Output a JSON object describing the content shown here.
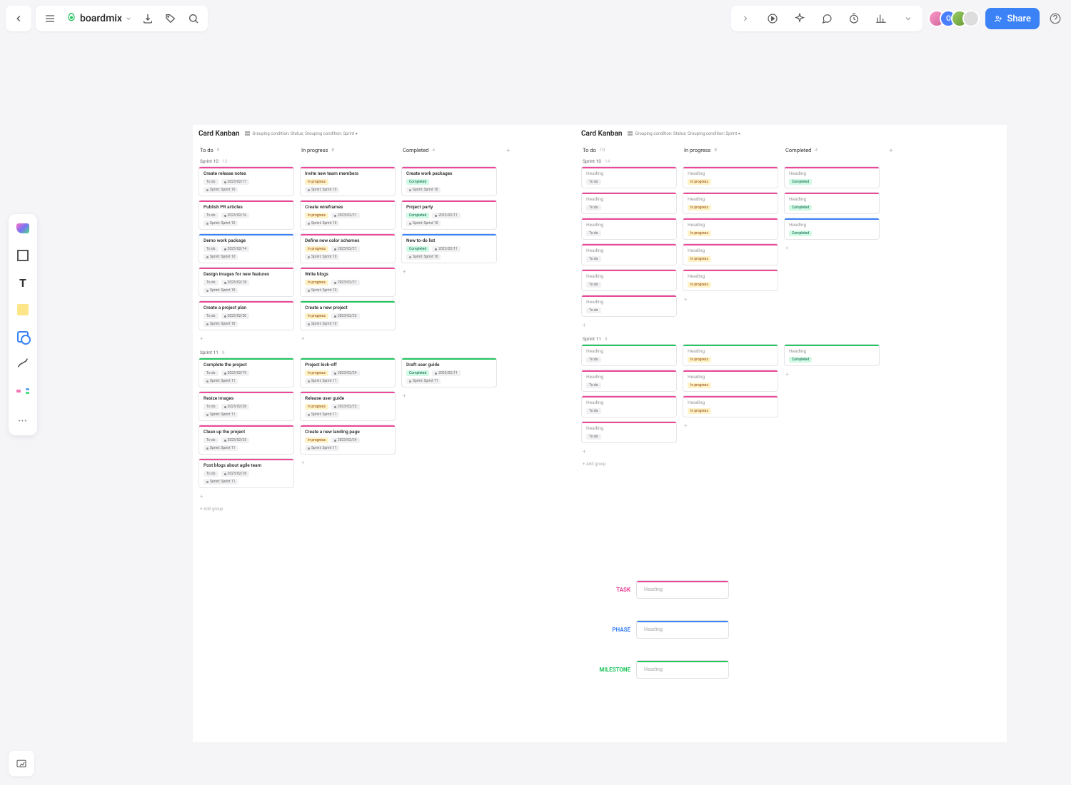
{
  "app": {
    "title": "boardmix",
    "share": "Share"
  },
  "status_labels": {
    "todo": "To do",
    "inprogress": "In progress",
    "completed": "Completed"
  },
  "board1": {
    "title": "Card Kanban",
    "condition": "Grouping condition: Status; Grouping condition: Sprint ▾",
    "columns": [
      {
        "name": "To do",
        "count": 9
      },
      {
        "name": "In progress",
        "count": 8
      },
      {
        "name": "Completed",
        "count": 4
      }
    ],
    "groups": [
      {
        "name": "Sprint 10",
        "count": 13,
        "cols": [
          [
            {
              "title": "Create release notes",
              "status": "todo",
              "date": "2023/02/17",
              "sprint": "Sprint: Sprint 10",
              "color": "pink"
            },
            {
              "title": "Publish PR articles",
              "status": "todo",
              "date": "2023/02/16",
              "sprint": "Sprint: Sprint 10",
              "color": "pink"
            },
            {
              "title": "Demo work package",
              "status": "todo",
              "date": "2023/02/14",
              "sprint": "Sprint: Sprint 10",
              "color": "blue"
            },
            {
              "title": "Design images for new features",
              "status": "todo",
              "date": "2023/02/18",
              "sprint": "Sprint: Sprint 10",
              "color": "pink"
            },
            {
              "title": "Create a project plan",
              "status": "todo",
              "date": "2023/02/20",
              "sprint": "Sprint: Sprint 10",
              "color": "pink"
            }
          ],
          [
            {
              "title": "Invite new team members",
              "status": "inprogress",
              "date": "",
              "sprint": "Sprint: Sprint 10",
              "color": "pink"
            },
            {
              "title": "Create wireframes",
              "status": "inprogress",
              "date": "2023/02/21",
              "sprint": "Sprint: Sprint 10",
              "color": "pink"
            },
            {
              "title": "Define new color schemes",
              "status": "inprogress",
              "date": "2023/02/21",
              "sprint": "Sprint: Sprint 10",
              "color": "pink"
            },
            {
              "title": "Write blogs",
              "status": "inprogress",
              "date": "2023/02/21",
              "sprint": "Sprint: Sprint 10",
              "color": "pink"
            },
            {
              "title": "Create a new project",
              "status": "inprogress",
              "date": "2023/02/22",
              "sprint": "Sprint: Sprint 10",
              "color": "green"
            }
          ],
          [
            {
              "title": "Create work packages",
              "status": "completed",
              "date": "",
              "sprint": "Sprint: Sprint 10",
              "color": "pink"
            },
            {
              "title": "Project party",
              "status": "completed",
              "date": "2023/02/11",
              "sprint": "Sprint: Sprint 10",
              "color": "pink"
            },
            {
              "title": "New to-do list",
              "status": "completed",
              "date": "2023/02/11",
              "sprint": "Sprint: Sprint 10",
              "color": "blue"
            }
          ]
        ]
      },
      {
        "name": "Sprint 11",
        "count": 8,
        "cols": [
          [
            {
              "title": "Complete the project",
              "status": "todo",
              "date": "2023/02/19",
              "sprint": "Sprint: Sprint 11",
              "color": "green"
            },
            {
              "title": "Resize images",
              "status": "todo",
              "date": "2023/02/28",
              "sprint": "Sprint: Sprint 11",
              "color": "pink"
            },
            {
              "title": "Clean up the project",
              "status": "todo",
              "date": "2023/02/25",
              "sprint": "Sprint: Sprint 11",
              "color": "pink"
            },
            {
              "title": "Post blogs about agile team",
              "status": "todo",
              "date": "2023/02/18",
              "sprint": "Sprint: Sprint 11",
              "color": "pink"
            }
          ],
          [
            {
              "title": "Project kick-off",
              "status": "inprogress",
              "date": "2023/02/24",
              "sprint": "Sprint: Sprint 11",
              "color": "green"
            },
            {
              "title": "Release user guide",
              "status": "inprogress",
              "date": "2023/02/23",
              "sprint": "Sprint: Sprint 11",
              "color": "pink"
            },
            {
              "title": "Create a new landing page",
              "status": "inprogress",
              "date": "2023/02/24",
              "sprint": "Sprint: Sprint 11",
              "color": "pink"
            }
          ],
          [
            {
              "title": "Draft user guide",
              "status": "completed",
              "date": "2023/02/11",
              "sprint": "Sprint: Sprint 11",
              "color": "green"
            }
          ]
        ]
      }
    ],
    "add_group": "Add group"
  },
  "board2": {
    "title": "Card Kanban",
    "condition": "Grouping condition: Status; Grouping condition: Sprint ▾",
    "columns": [
      {
        "name": "To do",
        "count": 10
      },
      {
        "name": "In progress",
        "count": 8
      },
      {
        "name": "Completed",
        "count": 4
      }
    ],
    "groups": [
      {
        "name": "Sprint 10",
        "count": 14,
        "cols": [
          [
            {
              "title": "Heading",
              "status": "todo",
              "color": "pink",
              "placeholder": true
            },
            {
              "title": "Heading",
              "status": "todo",
              "color": "pink",
              "placeholder": true
            },
            {
              "title": "Heading",
              "status": "todo",
              "color": "pink",
              "placeholder": true
            },
            {
              "title": "Heading",
              "status": "todo",
              "color": "pink",
              "placeholder": true
            },
            {
              "title": "Heading",
              "status": "todo",
              "color": "pink",
              "placeholder": true
            },
            {
              "title": "Heading",
              "status": "todo",
              "color": "pink",
              "placeholder": true
            }
          ],
          [
            {
              "title": "Heading",
              "status": "inprogress",
              "color": "pink",
              "placeholder": true
            },
            {
              "title": "Heading",
              "status": "inprogress",
              "color": "pink",
              "placeholder": true
            },
            {
              "title": "Heading",
              "status": "inprogress",
              "color": "pink",
              "placeholder": true
            },
            {
              "title": "Heading",
              "status": "inprogress",
              "color": "pink",
              "placeholder": true
            },
            {
              "title": "Heading",
              "status": "inprogress",
              "color": "pink",
              "placeholder": true
            }
          ],
          [
            {
              "title": "Heading",
              "status": "completed",
              "color": "pink",
              "placeholder": true
            },
            {
              "title": "Heading",
              "status": "completed",
              "color": "pink",
              "placeholder": true
            },
            {
              "title": "Heading",
              "status": "completed",
              "color": "blue",
              "placeholder": true
            }
          ]
        ]
      },
      {
        "name": "Sprint 11",
        "count": 8,
        "cols": [
          [
            {
              "title": "Heading",
              "status": "todo",
              "color": "green",
              "placeholder": true
            },
            {
              "title": "Heading",
              "status": "todo",
              "color": "pink",
              "placeholder": true
            },
            {
              "title": "Heading",
              "status": "todo",
              "color": "pink",
              "placeholder": true
            },
            {
              "title": "Heading",
              "status": "todo",
              "color": "pink",
              "placeholder": true
            }
          ],
          [
            {
              "title": "Heading",
              "status": "inprogress",
              "color": "green",
              "placeholder": true
            },
            {
              "title": "Heading",
              "status": "inprogress",
              "color": "pink",
              "placeholder": true
            },
            {
              "title": "Heading",
              "status": "inprogress",
              "color": "pink",
              "placeholder": true
            }
          ],
          [
            {
              "title": "Heading",
              "status": "completed",
              "color": "green",
              "placeholder": true
            }
          ]
        ]
      }
    ],
    "add_group": "Add group"
  },
  "legend": {
    "rows": [
      {
        "label": "TASK",
        "class": "task",
        "color": "pink",
        "heading": "Heading"
      },
      {
        "label": "PHASE",
        "class": "phase",
        "color": "blue",
        "heading": "Heading"
      },
      {
        "label": "MILESTONE",
        "class": "milestone",
        "color": "green",
        "heading": "Heading"
      }
    ]
  }
}
